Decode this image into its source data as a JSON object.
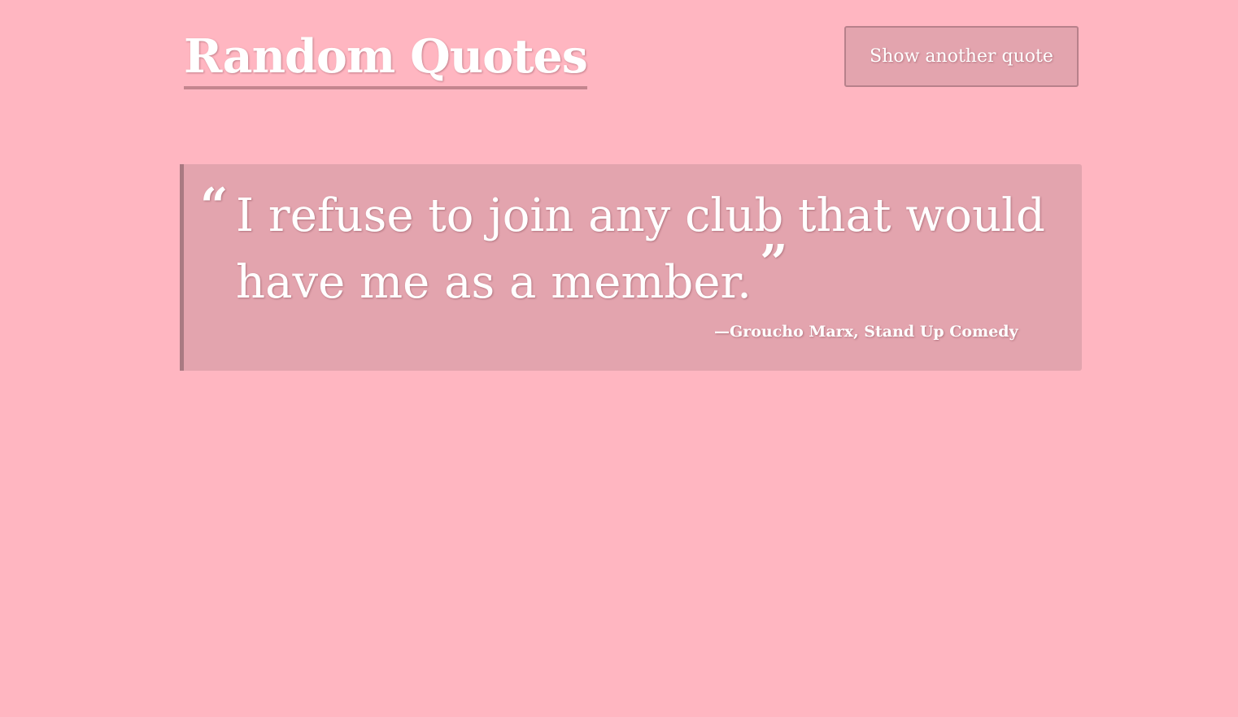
{
  "header": {
    "title": "Random Quotes",
    "next_button_label": "Show another quote"
  },
  "quote": {
    "open_mark": "“",
    "text": "I refuse to join any club that would have me as a member.",
    "close_mark": "”",
    "attribution": "—Groucho Marx, Stand Up Comedy"
  },
  "colors": {
    "background": "#ffb6c1",
    "card": "#e3a4ae",
    "accent_border": "#a97a82",
    "text": "#ffffff"
  }
}
